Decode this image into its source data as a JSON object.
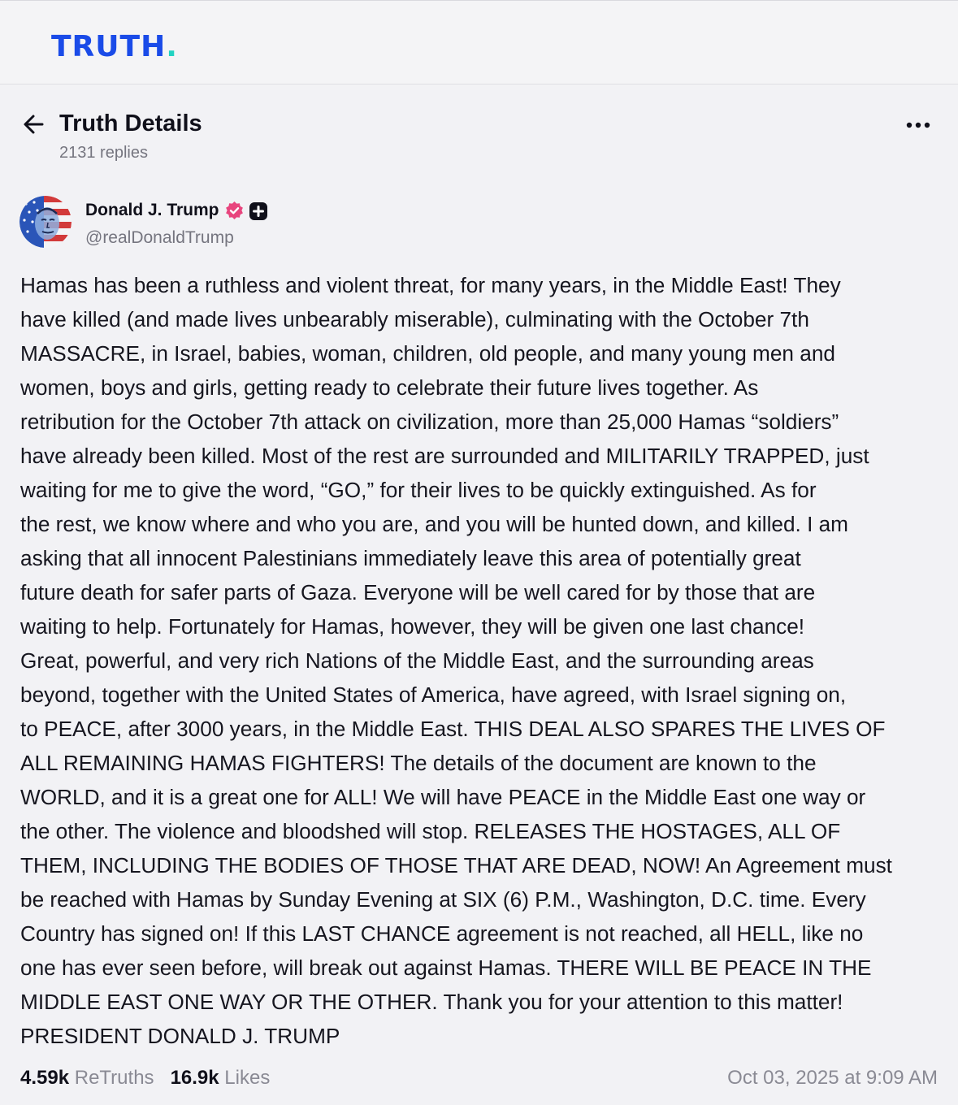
{
  "app": {
    "logo_text": "TRUTH",
    "logo_dot": ".",
    "brand_color": "#1a4be8",
    "accent_color": "#21d3c2"
  },
  "header": {
    "back_icon": "arrow-left-icon",
    "title": "Truth Details",
    "reply_count": "2131 replies",
    "more_icon": "ellipsis-horizontal-icon"
  },
  "author": {
    "name": "Donald J. Trump",
    "handle": "@realDonaldTrump",
    "verified_icon": "verified-badge-icon",
    "verified_color": "#e8457e",
    "plus_icon": "plus-badge-icon"
  },
  "post": {
    "text": "Hamas has been a ruthless and violent threat, for many years, in the Middle East! They\nhave killed (and made lives unbearably miserable), culminating with the October 7th\nMASSACRE, in Israel, babies, woman, children, old people, and many young men and\nwomen, boys and girls, getting ready to celebrate their future lives together. As\nretribution for the October 7th attack on civilization, more than 25,000 Hamas “soldiers”\nhave already been killed. Most of the rest are surrounded and MILITARILY TRAPPED, just\nwaiting for me to give the word, “GO,” for their lives to be quickly extinguished. As for\nthe rest, we know where and who you are, and you will be hunted down, and killed. I am\nasking that all innocent Palestinians immediately leave this area of potentially great\nfuture death for safer parts of Gaza. Everyone will be well cared for by those that are\nwaiting to help. Fortunately for Hamas, however, they will be given one last chance!\nGreat, powerful, and very rich Nations of the Middle East, and the surrounding areas\nbeyond, together with the United States of America, have agreed, with Israel signing on,\nto PEACE, after 3000 years, in the Middle East. THIS DEAL ALSO SPARES THE LIVES OF\nALL REMAINING HAMAS FIGHTERS! The details of the document are known to the\nWORLD, and it is a great one for ALL! We will have PEACE in the Middle East one way or\nthe other. The violence and bloodshed will stop. RELEASES THE HOSTAGES, ALL OF\nTHEM, INCLUDING THE BODIES OF THOSE THAT ARE DEAD, NOW! An Agreement must\nbe reached with Hamas by Sunday Evening at SIX (6) P.M., Washington, D.C. time. Every\nCountry has signed on! If this LAST CHANCE agreement is not reached, all HELL, like no\none has ever seen before, will break out against Hamas. THERE WILL BE PEACE IN THE\nMIDDLE EAST ONE WAY OR THE OTHER. Thank you for your attention to this matter!\nPRESIDENT DONALD J. TRUMP",
    "retruths_count": "4.59k",
    "retruths_label": "ReTruths",
    "likes_count": "16.9k",
    "likes_label": "Likes",
    "timestamp": "Oct 03, 2025 at 9:09 AM"
  }
}
